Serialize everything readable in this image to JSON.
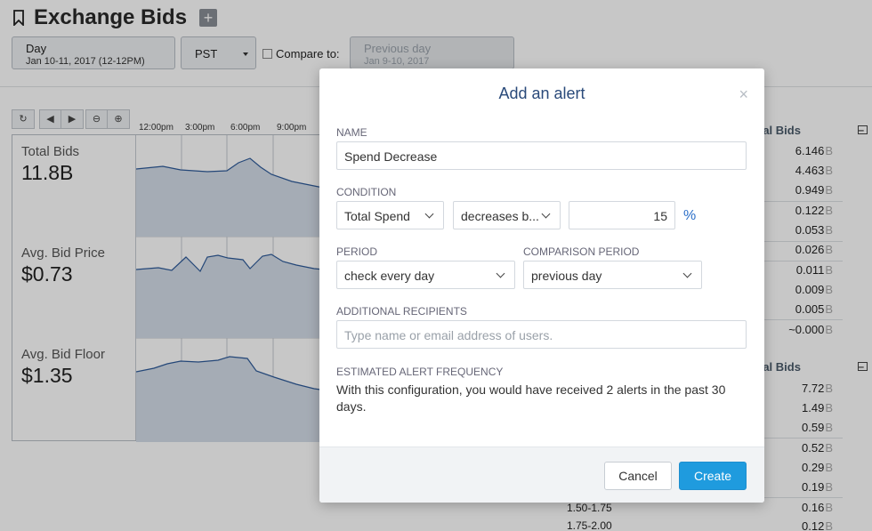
{
  "page": {
    "title": "Exchange Bids",
    "add_label": "+",
    "date_control": {
      "label": "Day",
      "range": "Jan 10-11, 2017 (12-12PM)"
    },
    "timezone": "PST",
    "compare_label": "Compare to:",
    "prev_control": {
      "label": "Previous day",
      "range": "Jan 9-10, 2017"
    },
    "toolbar": [
      "↻",
      "◀",
      "▶",
      "⊖",
      "⊕"
    ],
    "time_labels": [
      "12:00pm",
      "3:00pm",
      "6:00pm",
      "9:00pm"
    ],
    "metrics": [
      {
        "label": "Total Bids",
        "value": "11.8B"
      },
      {
        "label": "Avg. Bid Price",
        "value": "$0.73"
      },
      {
        "label": "Avg. Bid Floor",
        "value": "$1.35"
      }
    ],
    "right_tables": [
      {
        "header": "tal Bids",
        "values": [
          "6.146",
          "4.463",
          "0.949",
          "0.122",
          "0.053",
          "0.026",
          "0.011",
          "0.009",
          "0.005",
          "~0.000"
        ]
      },
      {
        "header": "tal Bids",
        "values": [
          "7.72",
          "1.49",
          "0.59",
          "0.52",
          "0.29",
          "0.19",
          "0.16",
          "0.12"
        ]
      }
    ],
    "unit_suffix": "B",
    "range_labels": [
      "1.50-1.75",
      "1.75-2.00"
    ]
  },
  "modal": {
    "title": "Add an alert",
    "close": "×",
    "name_label": "NAME",
    "name_value": "Spend Decrease",
    "condition_label": "CONDITION",
    "condition_metric": "Total Spend",
    "condition_operator": "decreases b...",
    "condition_value": "15",
    "condition_unit": "%",
    "period_label": "PERIOD",
    "period_value": "check every day",
    "comparison_label": "COMPARISON PERIOD",
    "comparison_value": "previous day",
    "recipients_label": "ADDITIONAL RECIPIENTS",
    "recipients_placeholder": "Type name or email address of users.",
    "freq_label": "ESTIMATED ALERT FREQUENCY",
    "freq_text": "With this configuration, you would have received 2 alerts in the past 30 days.",
    "cancel_label": "Cancel",
    "create_label": "Create"
  },
  "colors": {
    "accent": "#1f9bde",
    "title_blue": "#2a4a7a",
    "chart_fill": "#d4dde8",
    "chart_line": "#2f5b9a"
  }
}
